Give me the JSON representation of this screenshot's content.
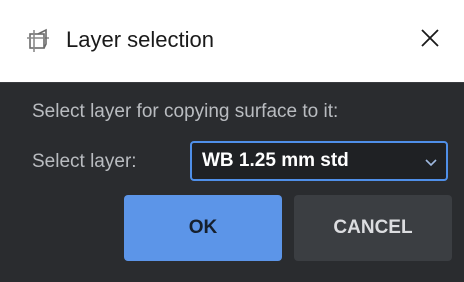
{
  "window": {
    "title": "Layer selection",
    "icon": "layer-copy-icon",
    "close_icon": "close-icon"
  },
  "dialog": {
    "prompt": "Select layer for copying surface to it:",
    "layer_label": "Select layer:",
    "layer_select": {
      "selected": "WB 1.25 mm std"
    },
    "ok_label": "OK",
    "cancel_label": "CANCEL"
  },
  "colors": {
    "accent": "#5c95e8",
    "background": "#2a2c2f",
    "titlebar": "#ffffff"
  }
}
